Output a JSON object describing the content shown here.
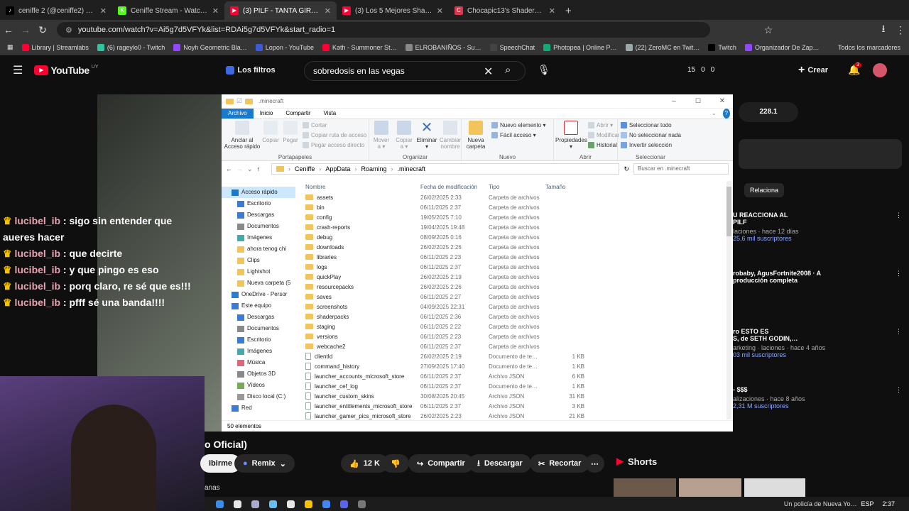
{
  "browser": {
    "tabs": [
      {
        "title": "ceniffe 2 (@ceniffe2) está emitie…",
        "color": "#000000",
        "glyph": "♪"
      },
      {
        "title": "Ceniffe Stream - Watch Live on …",
        "color": "#53fc18",
        "glyph": "K"
      },
      {
        "title": "(3) PILF - TANTA GIRA (Vid…",
        "color": "#ff0033",
        "glyph": "▶"
      },
      {
        "title": "(3) Los 5 Mejores Shaders para…",
        "color": "#ff0033",
        "glyph": "▶"
      },
      {
        "title": "Chocapic13's Shaders para Min…",
        "color": "#e0344c",
        "glyph": "C"
      }
    ],
    "url": "youtube.com/watch?v=Ai5g7d5VFYk&list=RDAi5g7d5VFYk&start_radio=1",
    "bookmarks": [
      "Library | Streamlabs",
      "(6) rageylo0 - Twitch",
      "Noyh Geometric Bla…",
      "Lopon - YouTube",
      "Kəth - Summoner St…",
      "ELROBANIÑOS - Su…",
      "SpeechChat",
      "Photopea | Online P…",
      "(22) ZeroMC en Twit…",
      "Twitch",
      "Organizador De Zap…"
    ],
    "all_bookmarks": "Todos los marcadores"
  },
  "youtube": {
    "logo": "YouTube",
    "country": "UY",
    "filters": "Los filtros",
    "search_value": "sobredosis en las vegas",
    "stat1": "15",
    "stat2": "0",
    "stat3": "0",
    "create": "Crear",
    "notif": "3",
    "video_title_fragment": "o Oficial)",
    "subscribe_fragment": "ibirme",
    "remix": "Remix",
    "likes": "12 K",
    "share": "Compartir",
    "download": "Descargar",
    "clip": "Recortar",
    "shorts": "Shorts",
    "chip": "Relaciona",
    "counter": "228.1",
    "side": [
      {
        "t": "U REACCIONA AL",
        "t2": "PILF",
        "m": "laciones · hace 12 días",
        "s": "25,6 mil suscriptores"
      },
      {
        "t": "robaby, AgusFortnite2008 · A",
        "t2": "producción completa",
        "m": "",
        "s": ""
      },
      {
        "t": "ro ESTO ES",
        "t2": "S, de SETH GODIN,…",
        "m": "arketing · laciones · hace 4 años",
        "s": "03 mil suscriptores"
      },
      {
        "t": "- $$$",
        "t2": "",
        "m": "alizaciones · hace 8 años",
        "s": "2,31 M suscriptores"
      }
    ],
    "bottom_left": "anas",
    "taskbar_text": "Un policía de Nueva Yo…",
    "lang": "ESP",
    "time": "2:37"
  },
  "chat": [
    {
      "user": "lucibel_ib",
      "msg": "sigo sin entender que aueres hacer"
    },
    {
      "user": "lucibel_ib",
      "msg": "que decirte"
    },
    {
      "user": "lucibel_ib",
      "msg": "y que pingo es eso"
    },
    {
      "user": "lucibel_ib",
      "msg": "porq claro, re sé que es!!!"
    },
    {
      "user": "lucibel_ib",
      "msg": "pfff sé una banda!!!!"
    }
  ],
  "explorer": {
    "title": ".minecraft",
    "ribbon_tabs": [
      "Archivo",
      "Inicio",
      "Compartir",
      "Vista"
    ],
    "portapapeles": {
      "label": "Portapapeles",
      "pin": "Anclar al\nAcceso rápido",
      "copy": "Copiar",
      "paste": "Pegar",
      "cut": "Cortar",
      "copypath": "Copiar ruta de acceso",
      "pasteshortcut": "Pegar acceso directo"
    },
    "organizar": {
      "label": "Organizar",
      "move": "Mover\na ▾",
      "copyto": "Copiar\na ▾",
      "delete": "Eliminar\n▾",
      "rename": "Cambiar\nnombre"
    },
    "nuevo": {
      "label": "Nuevo",
      "folder": "Nueva\ncarpeta",
      "item": "Nuevo elemento ▾",
      "easy": "Fácil acceso ▾"
    },
    "abrir": {
      "label": "Abrir",
      "props": "Propiedades\n▾",
      "open": "Abrir ▾",
      "edit": "Modificar",
      "history": "Historial"
    },
    "seleccionar": {
      "label": "Seleccionar",
      "all": "Seleccionar todo",
      "none": "No seleccionar nada",
      "invert": "Invertir selección"
    },
    "breadcrumb": [
      "Ceniffe",
      "AppData",
      "Roaming",
      ".minecraft"
    ],
    "search_placeholder": "Buscar en .minecraft",
    "columns": [
      "Nombre",
      "Fecha de modificación",
      "Tipo",
      "Tamaño"
    ],
    "tree": [
      "Acceso rápido",
      "Escritorio",
      "Descargas",
      "Documentos",
      "Imágenes",
      "ahora tenog chi",
      "Clips",
      "Lightshot",
      "Nueva carpeta (5",
      "OneDrive - Persor",
      "Este equipo",
      "Descargas",
      "Documentos",
      "Escritorio",
      "Imágenes",
      "Música",
      "Objetos 3D",
      "Vídeos",
      "Disco local (C:)",
      "Red"
    ],
    "files": [
      {
        "n": "assets",
        "d": "26/02/2025 2:33",
        "t": "Carpeta de archivos",
        "s": "",
        "f": true
      },
      {
        "n": "bin",
        "d": "06/11/2025 2:37",
        "t": "Carpeta de archivos",
        "s": "",
        "f": true
      },
      {
        "n": "config",
        "d": "19/05/2025 7:10",
        "t": "Carpeta de archivos",
        "s": "",
        "f": true
      },
      {
        "n": "crash-reports",
        "d": "19/04/2025 19:48",
        "t": "Carpeta de archivos",
        "s": "",
        "f": true
      },
      {
        "n": "debug",
        "d": "08/09/2025 0:16",
        "t": "Carpeta de archivos",
        "s": "",
        "f": true
      },
      {
        "n": "downloads",
        "d": "26/02/2025 2:26",
        "t": "Carpeta de archivos",
        "s": "",
        "f": true
      },
      {
        "n": "libraries",
        "d": "06/11/2025 2:23",
        "t": "Carpeta de archivos",
        "s": "",
        "f": true
      },
      {
        "n": "logs",
        "d": "06/11/2025 2:37",
        "t": "Carpeta de archivos",
        "s": "",
        "f": true
      },
      {
        "n": "quickPlay",
        "d": "26/02/2025 2:19",
        "t": "Carpeta de archivos",
        "s": "",
        "f": true
      },
      {
        "n": "resourcepacks",
        "d": "26/02/2025 2:26",
        "t": "Carpeta de archivos",
        "s": "",
        "f": true
      },
      {
        "n": "saves",
        "d": "06/11/2025 2:27",
        "t": "Carpeta de archivos",
        "s": "",
        "f": true
      },
      {
        "n": "screenshots",
        "d": "04/09/2025 22:31",
        "t": "Carpeta de archivos",
        "s": "",
        "f": true
      },
      {
        "n": "shaderpacks",
        "d": "06/11/2025 2:36",
        "t": "Carpeta de archivos",
        "s": "",
        "f": true
      },
      {
        "n": "staging",
        "d": "06/11/2025 2:22",
        "t": "Carpeta de archivos",
        "s": "",
        "f": true
      },
      {
        "n": "versions",
        "d": "06/11/2025 2:23",
        "t": "Carpeta de archivos",
        "s": "",
        "f": true
      },
      {
        "n": "webcache2",
        "d": "06/11/2025 2:37",
        "t": "Carpeta de archivos",
        "s": "",
        "f": true
      },
      {
        "n": "clientId",
        "d": "26/02/2025 2:19",
        "t": "Documento de te…",
        "s": "1 KB",
        "f": false
      },
      {
        "n": "command_history",
        "d": "27/09/2025 17:40",
        "t": "Documento de te…",
        "s": "1 KB",
        "f": false
      },
      {
        "n": "launcher_accounts_microsoft_store",
        "d": "06/11/2025 2:37",
        "t": "Archivo JSON",
        "s": "6 KB",
        "f": false
      },
      {
        "n": "launcher_cef_log",
        "d": "06/11/2025 2:37",
        "t": "Documento de te…",
        "s": "1 KB",
        "f": false
      },
      {
        "n": "launcher_custom_skins",
        "d": "30/08/2025 20:45",
        "t": "Archivo JSON",
        "s": "31 KB",
        "f": false
      },
      {
        "n": "launcher_entitlements_microsoft_store",
        "d": "06/11/2025 2:37",
        "t": "Archivo JSON",
        "s": "3 KB",
        "f": false
      },
      {
        "n": "launcher_gamer_pics_microsoft_store",
        "d": "26/02/2025 2:23",
        "t": "Archivo JSON",
        "s": "21 KB",
        "f": false
      }
    ],
    "status": "50 elementos"
  }
}
